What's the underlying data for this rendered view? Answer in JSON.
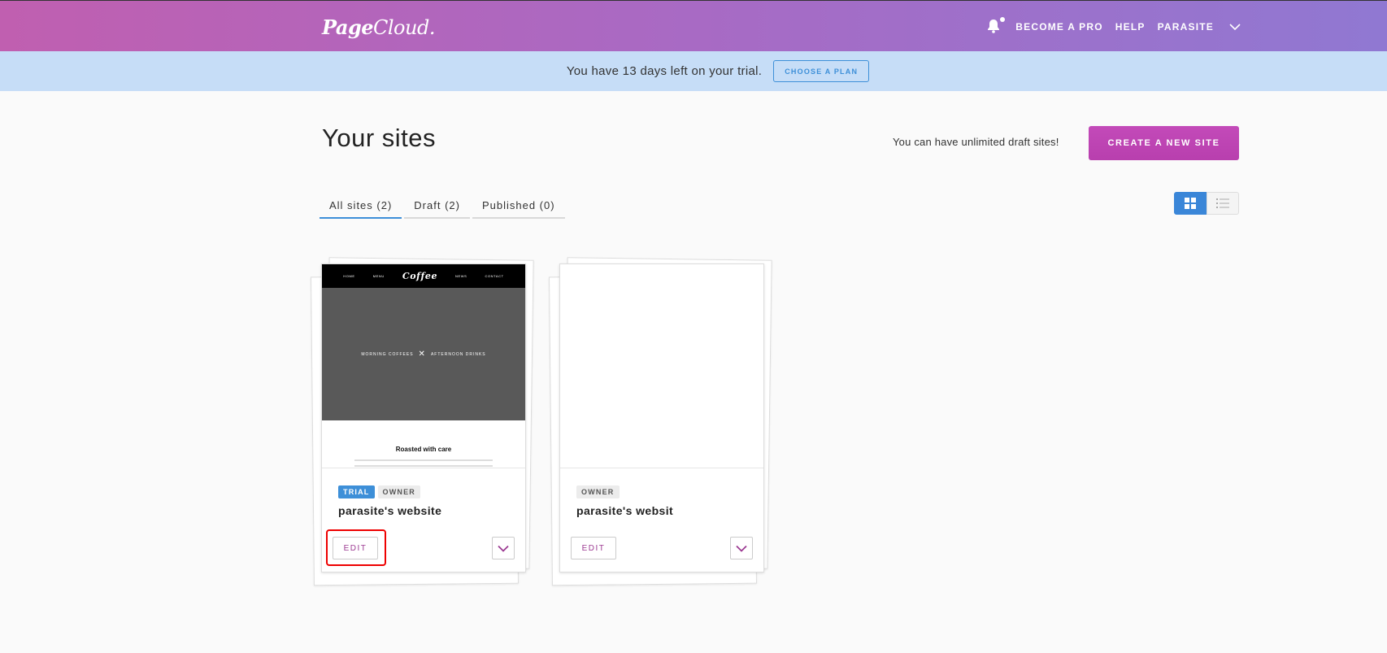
{
  "header": {
    "logo_text_bold": "Page",
    "logo_text_rest": "Cloud.",
    "nav": {
      "become_pro": "BECOME A PRO",
      "help": "HELP",
      "user": "PARASITE"
    },
    "icons": [
      "bell-icon",
      "chevron-down-icon"
    ]
  },
  "trial_banner": {
    "message": "You have 13 days left on your trial.",
    "cta": "CHOOSE A PLAN"
  },
  "main": {
    "title": "Your sites",
    "unlimited_note": "You can have unlimited draft sites!",
    "create_button": "CREATE A NEW SITE",
    "tabs": [
      {
        "label": "All sites (2)",
        "active": true
      },
      {
        "label": "Draft (2)",
        "active": false
      },
      {
        "label": "Published (0)",
        "active": false
      }
    ],
    "view_toggle": {
      "active": "grid",
      "icons": [
        "grid-view-icon",
        "list-view-icon"
      ]
    },
    "sites": [
      {
        "name": "parasite's website",
        "badges": [
          "TRIAL",
          "OWNER"
        ],
        "edit_label": "EDIT",
        "thumbnail": {
          "nav": [
            "HOME",
            "MENU",
            "Coffee",
            "NEWS",
            "CONTACT"
          ],
          "hero_left": "MORNING COFFEES",
          "hero_sep": "✕",
          "hero_right": "AFTERNOON DRINKS",
          "heading": "Roasted with care"
        }
      },
      {
        "name": "parasite's websit",
        "badges": [
          "OWNER"
        ],
        "edit_label": "EDIT"
      }
    ]
  },
  "colors": {
    "header_gradient": [
      "#c05fb0",
      "#9078d2"
    ],
    "banner_bg": "#c6ddf7",
    "accent_blue": "#3d8fd8",
    "create_button": "#c34ab9",
    "edit_text": "#9c3a92",
    "highlight": "#ee0000"
  }
}
